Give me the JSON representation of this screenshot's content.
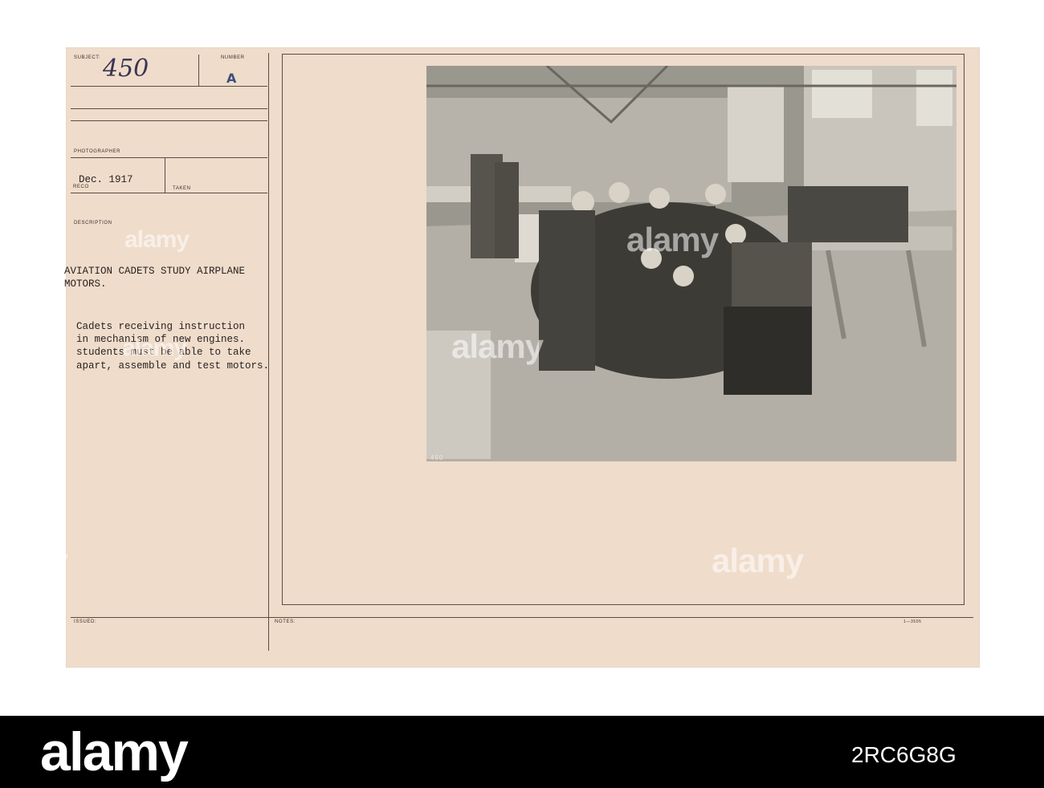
{
  "card": {
    "subject_label": "SUBJECT:",
    "subject_value": "450",
    "number_label": "NUMBER",
    "number_value": "A",
    "photographer_label": "PHOTOGRAPHER",
    "date_value": "Dec. 1917",
    "reco_label": "RECO",
    "taken_label": "TAKEN",
    "description_label": "DESCRIPTION",
    "title_lines": [
      "AVIATION CADETS STUDY AIRPLANE",
      "MOTORS."
    ],
    "body_lines": [
      "Cadets receiving instruction",
      "in mechanism of new engines.",
      "students must be able to take",
      "apart, assemble and test motors."
    ],
    "issued_label": "ISSUED:",
    "notes_label": "NOTES:",
    "form_code": "1—3505"
  },
  "photo": {
    "print_number": "450",
    "subject_icon": "workshop-photo-icon"
  },
  "watermark": {
    "text": "alamy"
  },
  "banner": {
    "logo": "alamy",
    "image_id": "2RC6G8G"
  },
  "colors": {
    "card": "#efdccb",
    "banner": "#000000",
    "ink": "#2a2220"
  }
}
